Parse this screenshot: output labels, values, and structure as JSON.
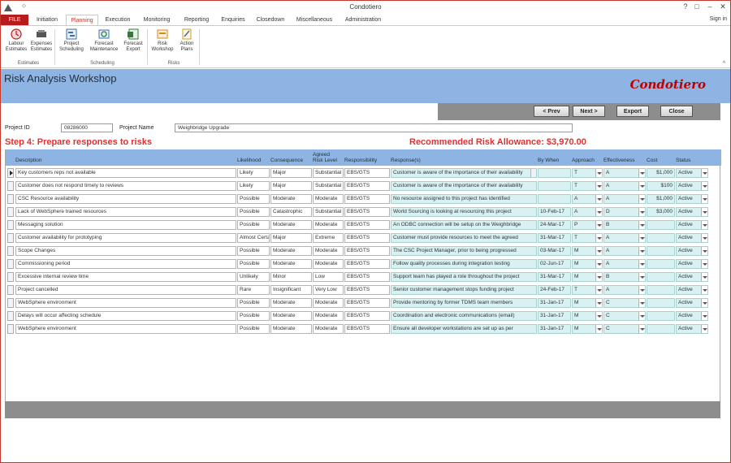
{
  "window": {
    "title": "Condotiero",
    "help": "?",
    "restore": "□",
    "minimize": "–",
    "close": "✕",
    "signin": "Sign in",
    "qa_arrow": "⬦"
  },
  "tabs": [
    "FILE",
    "Initiation",
    "Planning",
    "Execution",
    "Monitoring",
    "Reporting",
    "Enquiries",
    "Closedown",
    "Miscellaneous",
    "Administration"
  ],
  "ribbon": {
    "buttons": [
      {
        "l1": "Labour",
        "l2": "Estimates"
      },
      {
        "l1": "Expenses",
        "l2": "Estimates"
      },
      {
        "l1": "Project",
        "l2": "Scheduling"
      },
      {
        "l1": "Forecast",
        "l2": "Maintenance"
      },
      {
        "l1": "Forecast",
        "l2": "Export"
      },
      {
        "l1": "Risk",
        "l2": "Workshop"
      },
      {
        "l1": "Action",
        "l2": "Plans"
      }
    ],
    "groups": [
      "Estimates",
      "Scheduling",
      "Risks"
    ],
    "collapse": "^"
  },
  "header": {
    "title": "Risk Analysis Workshop",
    "brand": "Condotiero"
  },
  "nav": {
    "prev": "< Prev",
    "next": "Next >",
    "export": "Export",
    "close": "Close"
  },
  "project": {
    "id_label": "Project ID",
    "id_value": "08286000",
    "name_label": "Project Name",
    "name_value": "Weighbridge Upgrade"
  },
  "step_title": "Step 4: Prepare responses to risks",
  "allowance": "Recommended Risk Allowance: $3,970.00",
  "grid": {
    "headers": {
      "description": "Description",
      "likelihood": "Likelihood",
      "consequence": "Consequence",
      "agreed1": "Agreed",
      "agreed2": "Risk Level",
      "responsibility": "Responsibility",
      "response": "Response(s)",
      "bywhen": "By When",
      "approach": "Approach",
      "effectiveness": "Effectiveness",
      "cost": "Cost",
      "status": "Status"
    },
    "rows": [
      {
        "d": "Key customers reps not available",
        "l": "Likely",
        "c": "Major",
        "a": "Substantial",
        "r": "EBS/GTS",
        "resp": "Customer is aware of the importance of their availability",
        "w": "",
        "ap": "T",
        "e": "A",
        "cost": "$1,000",
        "s": "Active"
      },
      {
        "d": "Customer does not respond timely to reviews",
        "l": "Likely",
        "c": "Major",
        "a": "Substantial",
        "r": "EBS/GTS",
        "resp": "Customer is aware of the importance of their availability",
        "w": "",
        "ap": "T",
        "e": "A",
        "cost": "$100",
        "s": "Active"
      },
      {
        "d": "CSC Resource availability",
        "l": "Possible",
        "c": "Moderate",
        "a": "Moderate",
        "r": "EBS/GTS",
        "resp": "No resource assigned to this project has identified",
        "w": "",
        "ap": "A",
        "e": "A",
        "cost": "$1,000",
        "s": "Active"
      },
      {
        "d": "Lack of WebSphere trained resources",
        "l": "Possible",
        "c": "Catastrophic",
        "a": "Substantial",
        "r": "EBS/GTS",
        "resp": "World Sourcing is looking at resourcing this project",
        "w": "10-Feb-17",
        "ap": "A",
        "e": "D",
        "cost": "$3,000",
        "s": "Active"
      },
      {
        "d": "Messaging solution",
        "l": "Possible",
        "c": "Moderate",
        "a": "Moderate",
        "r": "EBS/GTS",
        "resp": "An ODBC connection will be setup on the Weighbridge",
        "w": "24-Mar-17",
        "ap": "P",
        "e": "B",
        "cost": "",
        "s": "Active"
      },
      {
        "d": "Customer availability for prototyping",
        "l": "Almost Certain",
        "c": "Major",
        "a": "Extreme",
        "r": "EBS/GTS",
        "resp": "Customer must provide resources to meet the agreed",
        "w": "31-Mar-17",
        "ap": "T",
        "e": "A",
        "cost": "",
        "s": "Active"
      },
      {
        "d": "Scope Changes",
        "l": "Possible",
        "c": "Moderate",
        "a": "Moderate",
        "r": "EBS/GTS",
        "resp": "The CSC Project Manager, prior to being progressed",
        "w": "03-Mar-17",
        "ap": "M",
        "e": "A",
        "cost": "",
        "s": "Active"
      },
      {
        "d": "Commissioning period",
        "l": "Possible",
        "c": "Moderate",
        "a": "Moderate",
        "r": "EBS/GTS",
        "resp": "Follow quality processes during integration testing",
        "w": "02-Jun-17",
        "ap": "M",
        "e": "A",
        "cost": "",
        "s": "Active"
      },
      {
        "d": "Excessive internal review time",
        "l": "Unlikely",
        "c": "Minor",
        "a": "Low",
        "r": "EBS/GTS",
        "resp": "Support team has played a role throughout the project",
        "w": "31-Mar-17",
        "ap": "M",
        "e": "B",
        "cost": "",
        "s": "Active"
      },
      {
        "d": "Project cancelled",
        "l": "Rare",
        "c": "Insignificant",
        "a": "Very Low",
        "r": "EBS/GTS",
        "resp": "Senior customer management stops funding project",
        "w": "24-Feb-17",
        "ap": "T",
        "e": "A",
        "cost": "",
        "s": "Active"
      },
      {
        "d": "WebSphere environment",
        "l": "Possible",
        "c": "Moderate",
        "a": "Moderate",
        "r": "EBS/GTS",
        "resp": "Provide mentoring by former TDMS team members",
        "w": "31-Jan-17",
        "ap": "M",
        "e": "C",
        "cost": "",
        "s": "Active"
      },
      {
        "d": "Delays will occur affecting schedule",
        "l": "Possible",
        "c": "Moderate",
        "a": "Moderate",
        "r": "EBS/GTS",
        "resp": "Coordination and electronic communications (email)",
        "w": "31-Jan-17",
        "ap": "M",
        "e": "C",
        "cost": "",
        "s": "Active"
      },
      {
        "d": "WebSphere environment",
        "l": "Possible",
        "c": "Moderate",
        "a": "Moderate",
        "r": "EBS/GTS",
        "resp": "Ensure all developer workstations are set up as per",
        "w": "31-Jan-17",
        "ap": "M",
        "e": "C",
        "cost": "",
        "s": "Active"
      }
    ]
  }
}
